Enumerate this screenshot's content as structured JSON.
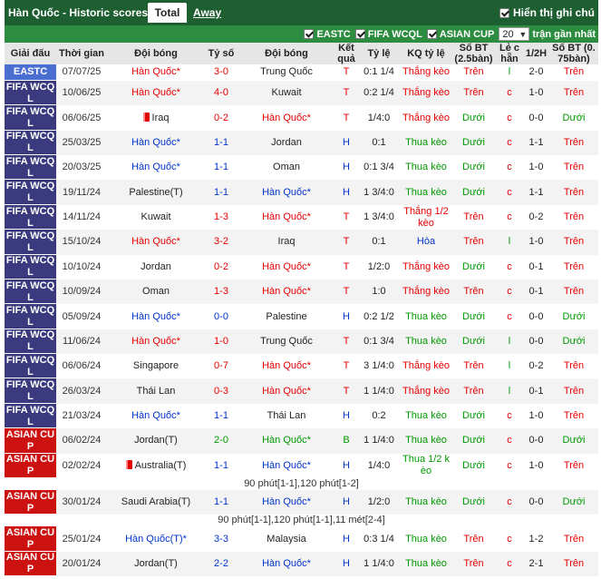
{
  "header": {
    "title": "Hàn Quốc - Historic scores",
    "tabs": [
      {
        "label": "Total",
        "active": true
      },
      {
        "label": "Away",
        "active": false
      }
    ],
    "show_notes": {
      "label": "Hiển thị ghi chú",
      "checked": true
    }
  },
  "filters": {
    "leagues": [
      {
        "label": "EASTC",
        "checked": true
      },
      {
        "label": "FIFA WCQL",
        "checked": true
      },
      {
        "label": "ASIAN CUP",
        "checked": true
      }
    ],
    "count": "20",
    "count_suffix": "trận gần nhất"
  },
  "columns": [
    "Giải đấu",
    "Thời gian",
    "Đội bóng",
    "Tỷ số",
    "Đội bóng",
    "Kết quả",
    "Tỷ lệ",
    "KQ tỷ lệ",
    "Số BT (2.5bàn)",
    "Lẻ chẵn",
    "1/2H",
    "Số BT (0.75bàn)"
  ],
  "colors": {
    "topbar": "#1e5f32",
    "filterbar": "#2c8c3f",
    "league": {
      "EASTC": "#4b6fd1",
      "FIFA WCQL": "#3b3a7f",
      "ASIAN CUP": "#cc1111"
    },
    "text": {
      "T": "#e60000",
      "H": "#0033cc",
      "B": "#009900",
      "Thắng kèo": "#e60000",
      "Thắng 1/2 kèo": "#e60000",
      "Thua kèo": "#009900",
      "Thua 1/2 kèo": "#009900",
      "Hòa": "#0033cc",
      "Trên": "#e60000",
      "Dưới": "#009900",
      "l": "#009900",
      "c": "#e60000"
    }
  },
  "matches": [
    {
      "league": "EASTC",
      "date": "07/07/25",
      "home": "Hàn Quốc*",
      "score": "3-0",
      "away": "Trung Quốc",
      "result": "T",
      "handicap": "0:1 1/4",
      "handicap_result": "Thắng kèo",
      "ou25": "Trên",
      "odd_even": "l",
      "ht": "2-0",
      "ou075": "Trên",
      "home_focus": true
    },
    {
      "league": "FIFA WCQL",
      "date": "10/06/25",
      "home": "Hàn Quốc*",
      "score": "4-0",
      "away": "Kuwait",
      "result": "T",
      "handicap": "0:2 1/4",
      "handicap_result": "Thắng kèo",
      "ou25": "Trên",
      "odd_even": "c",
      "ht": "1-0",
      "ou075": "Trên",
      "home_focus": true
    },
    {
      "league": "FIFA WCQL",
      "date": "06/06/25",
      "home": "Iraq",
      "home_red_card": true,
      "score": "0-2",
      "away": "Hàn Quốc*",
      "result": "T",
      "handicap": "1/4:0",
      "handicap_result": "Thắng kèo",
      "ou25": "Dưới",
      "odd_even": "c",
      "ht": "0-0",
      "ou075": "Dưới",
      "home_focus": false
    },
    {
      "league": "FIFA WCQL",
      "date": "25/03/25",
      "home": "Hàn Quốc*",
      "score": "1-1",
      "away": "Jordan",
      "result": "H",
      "handicap": "0:1",
      "handicap_result": "Thua kèo",
      "ou25": "Dưới",
      "odd_even": "c",
      "ht": "1-1",
      "ou075": "Trên",
      "home_focus": true
    },
    {
      "league": "FIFA WCQL",
      "date": "20/03/25",
      "home": "Hàn Quốc*",
      "score": "1-1",
      "away": "Oman",
      "result": "H",
      "handicap": "0:1 3/4",
      "handicap_result": "Thua kèo",
      "ou25": "Dưới",
      "odd_even": "c",
      "ht": "1-0",
      "ou075": "Trên",
      "home_focus": true
    },
    {
      "league": "FIFA WCQL",
      "date": "19/11/24",
      "home": "Palestine(T)",
      "score": "1-1",
      "away": "Hàn Quốc*",
      "result": "H",
      "handicap": "1 3/4:0",
      "handicap_result": "Thua kèo",
      "ou25": "Dưới",
      "odd_even": "c",
      "ht": "1-1",
      "ou075": "Trên",
      "home_focus": false
    },
    {
      "league": "FIFA WCQL",
      "date": "14/11/24",
      "home": "Kuwait",
      "score": "1-3",
      "away": "Hàn Quốc*",
      "result": "T",
      "handicap": "1 3/4:0",
      "handicap_result": "Thắng 1/2 kèo",
      "ou25": "Trên",
      "odd_even": "c",
      "ht": "0-2",
      "ou075": "Trên",
      "home_focus": false
    },
    {
      "league": "FIFA WCQL",
      "date": "15/10/24",
      "home": "Hàn Quốc*",
      "score": "3-2",
      "away": "Iraq",
      "result": "T",
      "handicap": "0:1",
      "handicap_result": "Hòa",
      "ou25": "Trên",
      "odd_even": "l",
      "ht": "1-0",
      "ou075": "Trên",
      "home_focus": true
    },
    {
      "league": "FIFA WCQL",
      "date": "10/10/24",
      "home": "Jordan",
      "score": "0-2",
      "away": "Hàn Quốc*",
      "result": "T",
      "handicap": "1/2:0",
      "handicap_result": "Thắng kèo",
      "ou25": "Dưới",
      "odd_even": "c",
      "ht": "0-1",
      "ou075": "Trên",
      "home_focus": false
    },
    {
      "league": "FIFA WCQL",
      "date": "10/09/24",
      "home": "Oman",
      "score": "1-3",
      "away": "Hàn Quốc*",
      "result": "T",
      "handicap": "1:0",
      "handicap_result": "Thắng kèo",
      "ou25": "Trên",
      "odd_even": "c",
      "ht": "0-1",
      "ou075": "Trên",
      "home_focus": false
    },
    {
      "league": "FIFA WCQL",
      "date": "05/09/24",
      "home": "Hàn Quốc*",
      "score": "0-0",
      "away": "Palestine",
      "result": "H",
      "handicap": "0:2 1/2",
      "handicap_result": "Thua kèo",
      "ou25": "Dưới",
      "odd_even": "c",
      "ht": "0-0",
      "ou075": "Dưới",
      "home_focus": true
    },
    {
      "league": "FIFA WCQL",
      "date": "11/06/24",
      "home": "Hàn Quốc*",
      "score": "1-0",
      "away": "Trung Quốc",
      "result": "T",
      "handicap": "0:1 3/4",
      "handicap_result": "Thua kèo",
      "ou25": "Dưới",
      "odd_even": "l",
      "ht": "0-0",
      "ou075": "Dưới",
      "home_focus": true
    },
    {
      "league": "FIFA WCQL",
      "date": "06/06/24",
      "home": "Singapore",
      "score": "0-7",
      "away": "Hàn Quốc*",
      "result": "T",
      "handicap": "3 1/4:0",
      "handicap_result": "Thắng kèo",
      "ou25": "Trên",
      "odd_even": "l",
      "ht": "0-2",
      "ou075": "Trên",
      "home_focus": false
    },
    {
      "league": "FIFA WCQL",
      "date": "26/03/24",
      "home": "Thái Lan",
      "score": "0-3",
      "away": "Hàn Quốc*",
      "result": "T",
      "handicap": "1 1/4:0",
      "handicap_result": "Thắng kèo",
      "ou25": "Trên",
      "odd_even": "l",
      "ht": "0-1",
      "ou075": "Trên",
      "home_focus": false
    },
    {
      "league": "FIFA WCQL",
      "date": "21/03/24",
      "home": "Hàn Quốc*",
      "score": "1-1",
      "away": "Thái Lan",
      "result": "H",
      "handicap": "0:2",
      "handicap_result": "Thua kèo",
      "ou25": "Dưới",
      "odd_even": "c",
      "ht": "1-0",
      "ou075": "Trên",
      "home_focus": true
    },
    {
      "league": "ASIAN CUP",
      "date": "06/02/24",
      "home": "Jordan(T)",
      "score": "2-0",
      "away": "Hàn Quốc*",
      "result": "B",
      "handicap": "1 1/4:0",
      "handicap_result": "Thua kèo",
      "ou25": "Dưới",
      "odd_even": "c",
      "ht": "0-0",
      "ou075": "Dưới",
      "home_focus": false
    },
    {
      "league": "ASIAN CUP",
      "date": "02/02/24",
      "home": "Australia(T)",
      "home_red_card": true,
      "score": "1-1",
      "away": "Hàn Quốc*",
      "result": "H",
      "handicap": "1/4:0",
      "handicap_result": "Thua 1/2 kèo",
      "ou25": "Dưới",
      "odd_even": "c",
      "ht": "1-0",
      "ou075": "Trên",
      "home_focus": false,
      "note": "90 phút[1-1],120 phút[1-2]"
    },
    {
      "league": "ASIAN CUP",
      "date": "30/01/24",
      "home": "Saudi Arabia(T)",
      "score": "1-1",
      "away": "Hàn Quốc*",
      "result": "H",
      "handicap": "1/2:0",
      "handicap_result": "Thua kèo",
      "ou25": "Dưới",
      "odd_even": "c",
      "ht": "0-0",
      "ou075": "Dưới",
      "home_focus": false,
      "note": "90 phút[1-1],120 phút[1-1],11 mét[2-4]"
    },
    {
      "league": "ASIAN CUP",
      "date": "25/01/24",
      "home": "Hàn Quốc(T)*",
      "score": "3-3",
      "away": "Malaysia",
      "result": "H",
      "handicap": "0:3 1/4",
      "handicap_result": "Thua kèo",
      "ou25": "Trên",
      "odd_even": "c",
      "ht": "1-2",
      "ou075": "Trên",
      "home_focus": true
    },
    {
      "league": "ASIAN CUP",
      "date": "20/01/24",
      "home": "Jordan(T)",
      "score": "2-2",
      "away": "Hàn Quốc*",
      "result": "H",
      "handicap": "1 1/4:0",
      "handicap_result": "Thua kèo",
      "ou25": "Trên",
      "odd_even": "c",
      "ht": "2-1",
      "ou075": "Trên",
      "home_focus": false
    }
  ]
}
